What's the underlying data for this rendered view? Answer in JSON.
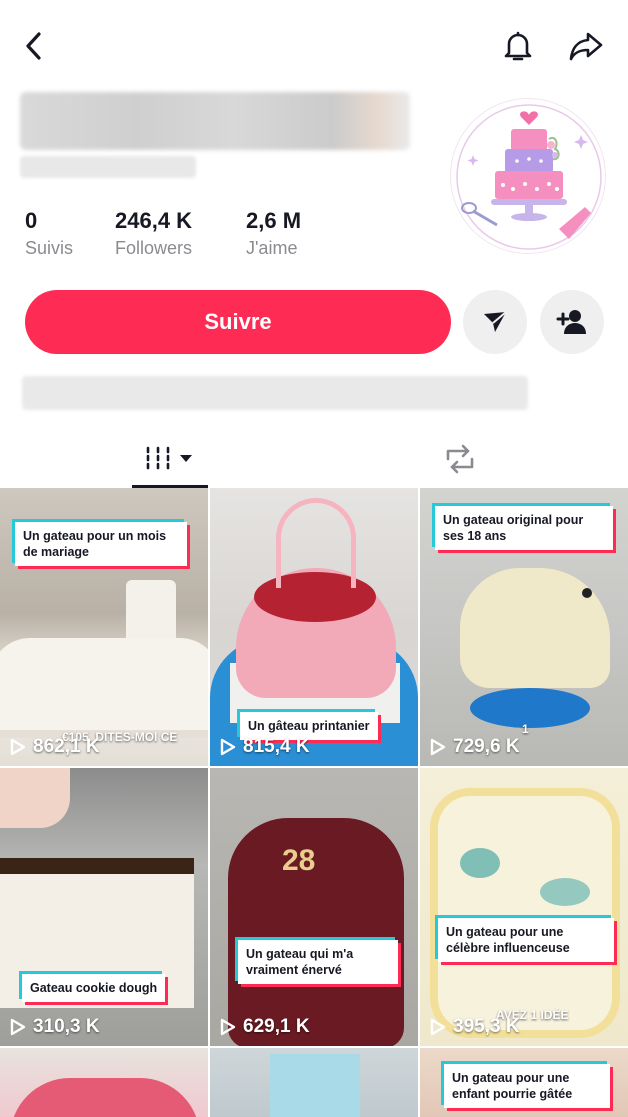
{
  "header": {
    "back_icon": "chevron-left-icon",
    "bell_icon": "bell-icon",
    "share_icon": "share-arrow-icon"
  },
  "stats": [
    {
      "value": "0",
      "label": "Suivis"
    },
    {
      "value": "246,4 K",
      "label": "Followers"
    },
    {
      "value": "2,6 M",
      "label": "J'aime"
    }
  ],
  "actions": {
    "follow_label": "Suivre",
    "message_icon": "send-icon",
    "add_friend_icon": "add-user-icon"
  },
  "tabs": {
    "videos_icon": "grid-videos-icon",
    "reposts_icon": "repost-icon"
  },
  "colors": {
    "accent": "#fe2c55",
    "cyan": "#25c9d7",
    "text": "#161823",
    "muted": "#8a8b91"
  },
  "videos": [
    {
      "caption": "Un gateau pour un mois de mariage",
      "views": "862,1 K",
      "extra": "€105. DITES-MOI CE"
    },
    {
      "caption": "Un gâteau printanier",
      "views": "815,4 K",
      "extra": ""
    },
    {
      "caption": "Un gateau original pour ses 18 ans",
      "views": "729,6 K",
      "extra": "1"
    },
    {
      "caption": "Gateau cookie dough",
      "views": "310,3 K",
      "extra": ""
    },
    {
      "caption": "Un gateau qui m'a vraiment énervé",
      "views": "629,1 K",
      "extra": "28"
    },
    {
      "caption": "Un gateau pour une célèbre influenceuse",
      "views": "395,3 K",
      "extra": "AVEZ 1 IDÉE"
    },
    {
      "caption": "",
      "views": "",
      "extra": ""
    },
    {
      "caption": "",
      "views": "",
      "extra": ""
    },
    {
      "caption": "Un gateau pour une enfant pourrie gâtée",
      "views": "",
      "extra": ""
    }
  ]
}
